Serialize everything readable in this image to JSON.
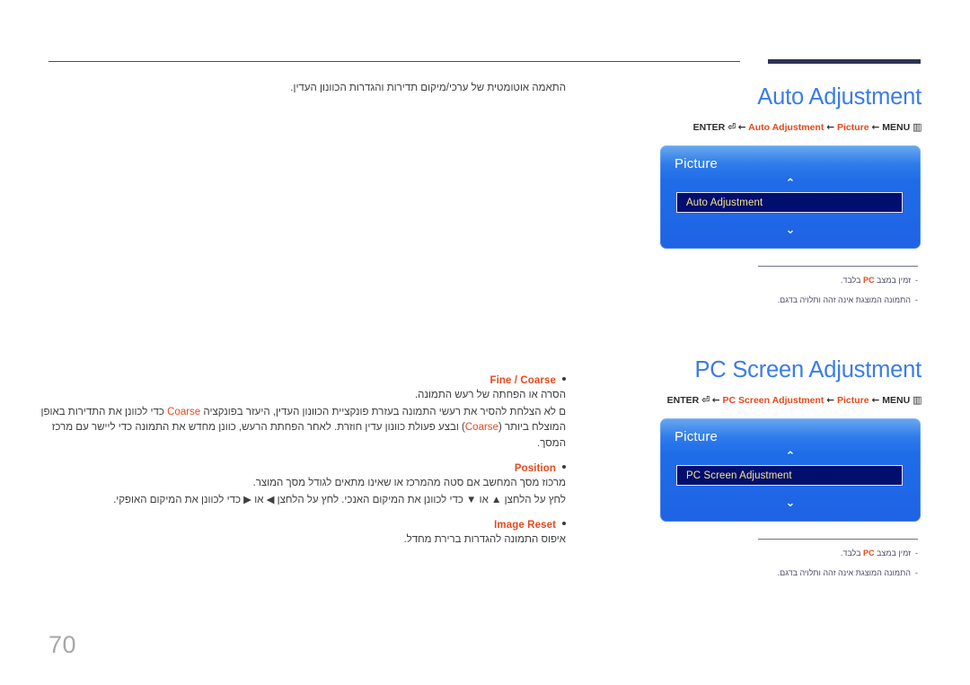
{
  "page": {
    "number": "70"
  },
  "left": {
    "intro": "התאמה אוטומטית של ערכי/מיקום תדירות והגדרות הכוונון העדין.",
    "sections": [
      {
        "title": "Fine / Coarse",
        "line1": "הסרה או הפחתה של רעש התמונה.",
        "line2_a": "ם לא הצלחת להסיר את רעשי התמונה בעזרת פונקציית הכוונון העדין, היעזר בפונקציה ",
        "line2_kw": "Coarse",
        "line2_b": " כדי לכוונן את התדירות באופן",
        "line3_a": "המוצלח ביותר (",
        "line3_kw": "Coarse",
        "line3_b": ") ובצע פעולת כוונון עדין חוזרת. לאחר הפחתת הרעש, כוונן מחדש את התמונה כדי ליישר עם מרכז המסך."
      },
      {
        "title": "Position",
        "line1": "מרכוז מסך המחשב אם סטה מהמרכז או שאינו מתאים לגודל מסך המוצר.",
        "line2": "לחץ על הלחצן ▲ או ▼ כדי לכוונן את המיקום האנכי. לחץ על הלחצן ◀ או ▶ כדי לכוונן את המיקום האופקי."
      },
      {
        "title": "Image Reset",
        "line1": "איפוס התמונה להגדרות ברירת מחדל."
      }
    ]
  },
  "right": {
    "blocks": [
      {
        "heading": "Auto Adjustment",
        "path": {
          "enter": "ENTER",
          "enter_icon": "⏎",
          "arrow": "←",
          "item": "Auto Adjustment",
          "parent": "Picture",
          "menu": "MENU",
          "menu_icon": "▥"
        },
        "osd": {
          "title": "Picture",
          "chevron_up": "⌃",
          "chevron_down": "⌄",
          "selected_row": "Auto Adjustment"
        },
        "notes": [
          {
            "dash": "-",
            "before": "זמין במצב ",
            "pc": "PC",
            "after": " בלבד."
          },
          {
            "dash": "-",
            "before": "התמונה המוצגת אינה זהה ותלויה בדגם.",
            "pc": "",
            "after": ""
          }
        ]
      },
      {
        "heading": "PC Screen Adjustment",
        "path": {
          "enter": "ENTER",
          "enter_icon": "⏎",
          "arrow": "←",
          "item": "PC Screen Adjustment",
          "parent": "Picture",
          "menu": "MENU",
          "menu_icon": "▥"
        },
        "osd": {
          "title": "Picture",
          "chevron_up": "⌃",
          "chevron_down": "⌄",
          "selected_row": "PC Screen Adjustment"
        },
        "notes": [
          {
            "dash": "-",
            "before": "זמין במצב ",
            "pc": "PC",
            "after": " בלבד."
          },
          {
            "dash": "-",
            "before": "התמונה המוצגת אינה זהה ותלויה בדגם.",
            "pc": "",
            "after": ""
          }
        ]
      }
    ]
  },
  "colors": {
    "heading_blue": "#3a7ce8",
    "accent_orange": "#e8491d",
    "rule_navy": "#2f3252",
    "osd_selected_bg": "#000e6e",
    "osd_selected_text": "#f6e58a"
  }
}
